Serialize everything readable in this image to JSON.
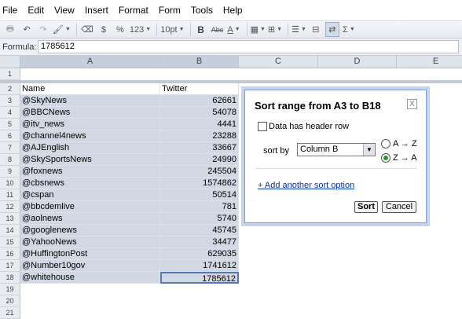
{
  "menu": [
    "File",
    "Edit",
    "View",
    "Insert",
    "Format",
    "Form",
    "Tools",
    "Help"
  ],
  "toolbar": {
    "currency": "$",
    "percent": "%",
    "number_format": "123",
    "font_size": "10pt",
    "bold": "B",
    "strike": "Abc",
    "text_color": "A",
    "sum": "Σ"
  },
  "formula": {
    "label": "Formula:",
    "value": "1785612"
  },
  "columns": [
    "A",
    "B",
    "C",
    "D",
    "E"
  ],
  "rows": [
    "1",
    "2",
    "3",
    "4",
    "5",
    "6",
    "7",
    "8",
    "9",
    "10",
    "11",
    "12",
    "13",
    "14",
    "15",
    "16",
    "17",
    "18",
    "19",
    "20",
    "21"
  ],
  "table": {
    "headers": [
      "Name",
      "Twitter"
    ],
    "data": [
      [
        "@SkyNews",
        "62661"
      ],
      [
        "@BBCNews",
        "54078"
      ],
      [
        "@itv_news",
        "4441"
      ],
      [
        "@channel4news",
        "23288"
      ],
      [
        "@AJEnglish",
        "33667"
      ],
      [
        "@SkySportsNews",
        "24990"
      ],
      [
        "@foxnews",
        "245504"
      ],
      [
        "@cbsnews",
        "1574862"
      ],
      [
        "@cspan",
        "50514"
      ],
      [
        "@bbcdemlive",
        "781"
      ],
      [
        "@aolnews",
        "5740"
      ],
      [
        "@googlenews",
        "45745"
      ],
      [
        "@YahooNews",
        "34477"
      ],
      [
        "@HuffingtonPost",
        "629035"
      ],
      [
        "@Number10gov",
        "1741612"
      ],
      [
        "@whitehouse",
        "1785612"
      ]
    ]
  },
  "dialog": {
    "title": "Sort range from A3 to B18",
    "close": "X",
    "header_row_label": "Data has header row",
    "sort_by_label": "sort by",
    "sort_column": "Column B",
    "asc_label": "A → Z",
    "desc_label": "Z → A",
    "add_sort_label": "+ Add another sort option",
    "sort_button": "Sort",
    "cancel_button": "Cancel"
  },
  "colors": {
    "selection": "#d2d8e3",
    "dialog_border": "#7f9ccb",
    "link": "#0033aa"
  }
}
